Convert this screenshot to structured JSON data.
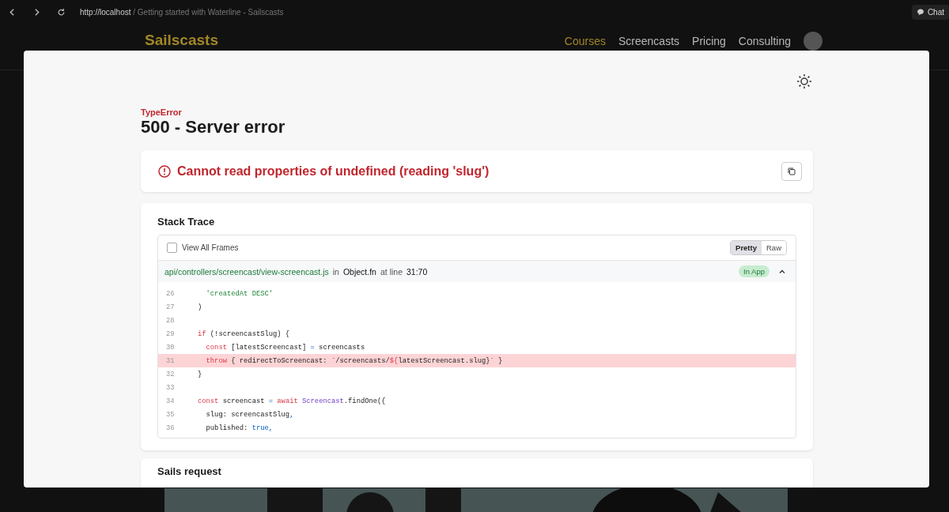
{
  "browser": {
    "url_host": "http://localhost",
    "url_rest": "/ Getting started with Waterline - Sailscasts",
    "chat": "Chat"
  },
  "site": {
    "logo": "Sailscasts",
    "nav": [
      {
        "label": "Courses",
        "selected": true
      },
      {
        "label": "Screencasts",
        "selected": false
      },
      {
        "label": "Pricing",
        "selected": false
      },
      {
        "label": "Consulting",
        "selected": false
      }
    ]
  },
  "error": {
    "type": "TypeError",
    "title": "500 - Server error",
    "message": "Cannot read properties of undefined (reading 'slug')"
  },
  "stack": {
    "title": "Stack Trace",
    "view_all": {
      "label": "View All Frames",
      "checked": false
    },
    "modes": [
      {
        "label": "Pretty",
        "selected": true
      },
      {
        "label": "Raw",
        "selected": false
      }
    ],
    "frame": {
      "file": "api/controllers/screencast/view-screencast.js",
      "in_label": "in",
      "fn": "Object.fn",
      "at_label": "at line",
      "line": "31:70",
      "badge": "In App",
      "expanded": true
    },
    "lines": [
      {
        "number": "26",
        "highlighted": false,
        "tokens": [
          {
            "text": "  'createdAt DESC'",
            "kind": "string"
          }
        ]
      },
      {
        "number": "27",
        "highlighted": false,
        "tokens": [
          {
            "text": ")",
            "kind": "plain"
          }
        ]
      },
      {
        "number": "28",
        "highlighted": false
      },
      {
        "number": "29",
        "highlighted": false,
        "tokens": [
          {
            "text": "if",
            "kind": "keyword"
          },
          {
            "text": " (!screencastSlug) {",
            "kind": "plain"
          }
        ]
      },
      {
        "number": "30",
        "highlighted": false,
        "tokens": [
          {
            "text": "  const",
            "kind": "keyword"
          },
          {
            "text": " [latestScreencast] ",
            "kind": "plain"
          },
          {
            "text": "=",
            "kind": "literal"
          },
          {
            "text": " screencasts",
            "kind": "plain"
          }
        ]
      },
      {
        "number": "31",
        "highlighted": true,
        "tokens": [
          {
            "text": "  throw",
            "kind": "keyword"
          },
          {
            "text": " { redirectToScreencast: `/screencasts/",
            "kind": "plain"
          },
          {
            "text": "${",
            "kind": "keyword"
          },
          {
            "text": "latestScreencast.slug}` }",
            "kind": "plain"
          }
        ]
      },
      {
        "number": "32",
        "highlighted": false,
        "tokens": [
          {
            "text": "}",
            "kind": "plain"
          }
        ]
      },
      {
        "number": "33",
        "highlighted": false
      },
      {
        "number": "34",
        "highlighted": false,
        "tokens": [
          {
            "text": "const",
            "kind": "keyword"
          },
          {
            "text": " screencast ",
            "kind": "plain"
          },
          {
            "text": "=",
            "kind": "literal"
          },
          {
            "text": " await",
            "kind": "keyword"
          },
          {
            "text": " Screencast",
            "kind": "class"
          },
          {
            "text": ".findOne({",
            "kind": "plain"
          }
        ]
      },
      {
        "number": "35",
        "highlighted": false,
        "tokens": [
          {
            "text": "  slug: screencastSlug",
            "kind": "plain"
          },
          {
            "text": ",",
            "kind": "literal"
          }
        ]
      },
      {
        "number": "36",
        "highlighted": false,
        "tokens": [
          {
            "text": "  published: ",
            "kind": "plain"
          },
          {
            "text": "true",
            "kind": "literal"
          },
          {
            "text": ",",
            "kind": "literal"
          }
        ]
      }
    ]
  },
  "next_card": {
    "title": "Sails request"
  }
}
